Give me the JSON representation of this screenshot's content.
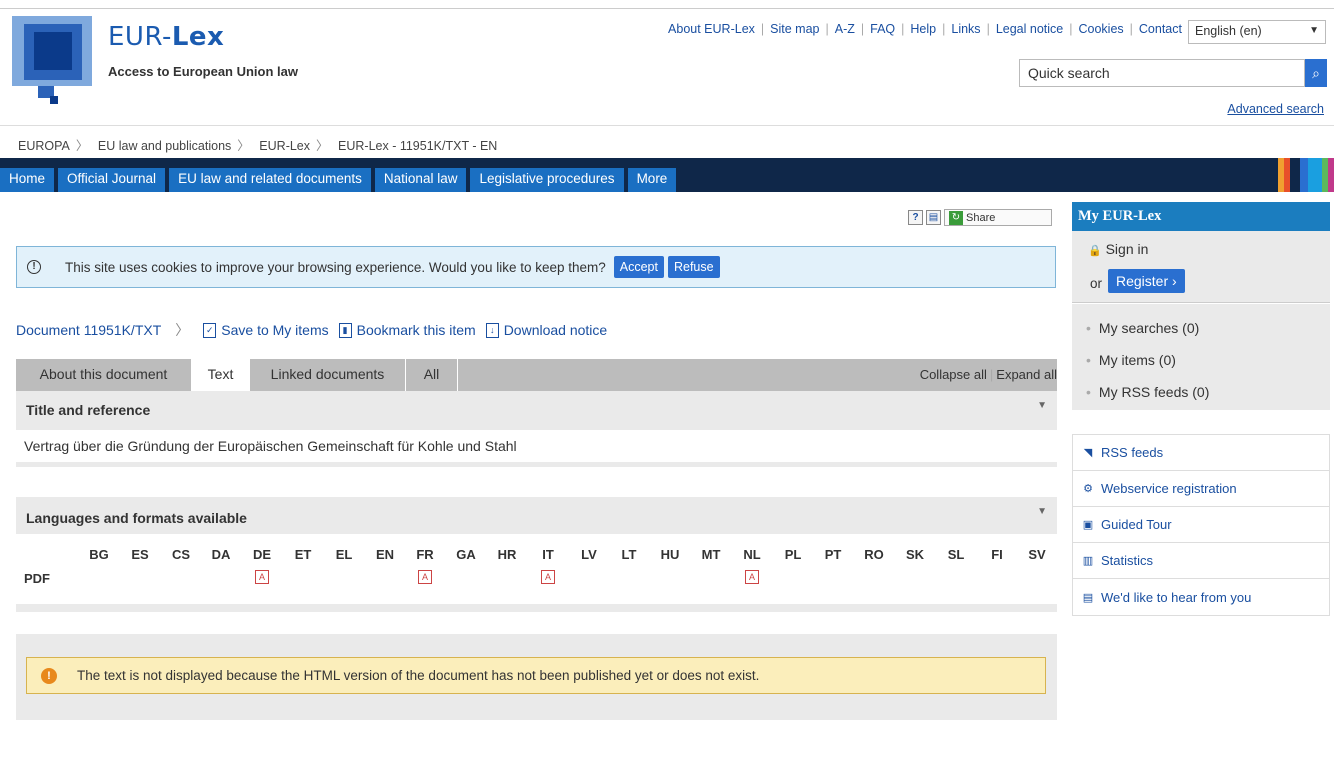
{
  "header": {
    "brand_prefix": "EUR-",
    "brand_suffix": "Lex",
    "tagline": "Access to European Union law",
    "top_links": [
      "About EUR-Lex",
      "Site map",
      "A-Z",
      "FAQ",
      "Help",
      "Links",
      "Legal notice",
      "Cookies",
      "Contact"
    ],
    "language": "English (en)",
    "search_placeholder": "Quick search",
    "advanced_search": "Advanced search"
  },
  "breadcrumb": [
    "EUROPA",
    "EU law and publications",
    "EUR-Lex",
    "EUR-Lex - 11951K/TXT - EN"
  ],
  "nav": {
    "tabs": [
      "Home",
      "Official Journal",
      "EU law and related documents",
      "National law",
      "Legislative procedures",
      "More"
    ]
  },
  "tools": {
    "help_icon": "?",
    "print_icon": "print-icon",
    "share_label": "Share"
  },
  "cookie": {
    "message": "This site uses cookies to improve your browsing experience. Would you like to keep them?",
    "accept": "Accept",
    "refuse": "Refuse"
  },
  "document": {
    "id_label": "Document 11951K/TXT",
    "save": "Save to My items",
    "bookmark": "Bookmark this item",
    "download": "Download notice",
    "tabs": [
      "About this document",
      "Text",
      "Linked documents",
      "All"
    ],
    "active_tab": "Text",
    "collapse_all": "Collapse all",
    "expand_all": "Expand all",
    "title_panel": "Title and reference",
    "title_text": "Vertrag über die Gründung der Europäischen Gemeinschaft für Kohle und Stahl",
    "languages_panel": "Languages and formats available",
    "format_label": "PDF",
    "languages": [
      "BG",
      "ES",
      "CS",
      "DA",
      "DE",
      "ET",
      "EL",
      "EN",
      "FR",
      "GA",
      "HR",
      "IT",
      "LV",
      "LT",
      "HU",
      "MT",
      "NL",
      "PL",
      "PT",
      "RO",
      "SK",
      "SL",
      "FI",
      "SV"
    ],
    "pdf_available": [
      "DE",
      "FR",
      "IT",
      "NL"
    ],
    "warning": "The text is not displayed because the HTML version of the document has not been published yet or does not exist."
  },
  "sidebar": {
    "title": "My EUR-Lex",
    "sign_in": "Sign in",
    "or": "or",
    "register": "Register ›",
    "my_items": [
      "My searches (0)",
      "My items (0)",
      "My RSS feeds (0)"
    ],
    "links": [
      {
        "label": "RSS feeds",
        "icon": "rss-icon"
      },
      {
        "label": "Webservice registration",
        "icon": "webservice-icon"
      },
      {
        "label": "Guided Tour",
        "icon": "guided-tour-icon"
      },
      {
        "label": "Statistics",
        "icon": "statistics-icon"
      },
      {
        "label": "We'd like to hear from you",
        "icon": "feedback-icon"
      }
    ]
  },
  "colors": {
    "nav_bg": "#0f2749",
    "tab_blue": "#1a6fc2",
    "button_blue": "#2a6fd0",
    "cookie_bg": "#e2f1fa",
    "warning_bg": "#fbeebb",
    "sidebar_head": "#1b7dbf"
  }
}
